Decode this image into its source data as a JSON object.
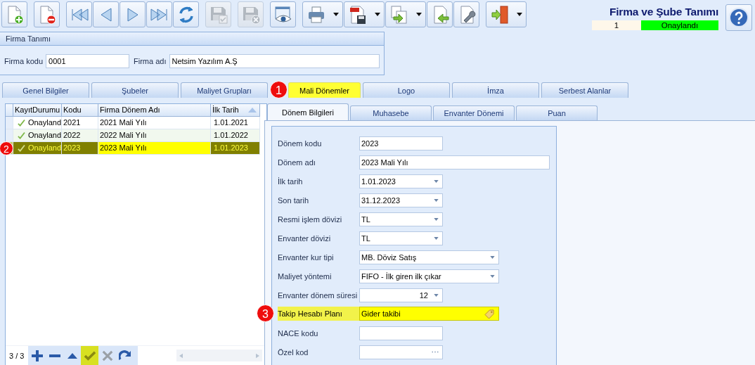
{
  "toolbar": [
    [
      {
        "kind": "new",
        "disabled": false,
        "dropdown": false
      }
    ],
    [
      {
        "kind": "delete",
        "disabled": false,
        "dropdown": false
      }
    ],
    [
      {
        "kind": "first",
        "disabled": false,
        "dropdown": false
      },
      {
        "kind": "prev",
        "disabled": false,
        "dropdown": false
      },
      {
        "kind": "next",
        "disabled": false,
        "dropdown": false
      },
      {
        "kind": "last",
        "disabled": false,
        "dropdown": false
      },
      {
        "kind": "refresh",
        "disabled": false,
        "dropdown": false
      }
    ],
    [
      {
        "kind": "save",
        "disabled": true,
        "dropdown": false
      }
    ],
    [
      {
        "kind": "cancel",
        "disabled": true,
        "dropdown": false
      }
    ],
    [
      {
        "kind": "preview",
        "disabled": false,
        "dropdown": false
      }
    ],
    [
      {
        "kind": "print",
        "disabled": false,
        "dropdown": true
      },
      {
        "kind": "pdf",
        "disabled": false,
        "dropdown": true
      },
      {
        "kind": "export",
        "disabled": false,
        "dropdown": true
      },
      {
        "kind": "import",
        "disabled": false,
        "dropdown": false
      },
      {
        "kind": "tools",
        "disabled": false,
        "dropdown": false
      }
    ],
    [
      {
        "kind": "exit",
        "disabled": false,
        "dropdown": true
      }
    ]
  ],
  "header": {
    "title": "Firma ve Şube Tanımı",
    "record_no": "1",
    "status": "Onaylandı"
  },
  "company": {
    "title": "Firma Tanımı",
    "fields": [
      {
        "label": "Firma kodu",
        "value": "0001"
      },
      {
        "label": "Firma adı",
        "value": "Netsim Yazılım A.Ş"
      }
    ]
  },
  "main_tabs": [
    {
      "label": "Genel Bilgiler",
      "selected": false
    },
    {
      "label": "Şubeler",
      "selected": false
    },
    {
      "label": "Maliyet Grupları",
      "selected": false
    },
    {
      "label": "Mali Dönemler",
      "selected": true,
      "marker": "1"
    },
    {
      "label": "Logo",
      "selected": false
    },
    {
      "label": "İmza",
      "selected": false
    },
    {
      "label": "Serbest Alanlar",
      "selected": false
    }
  ],
  "grid": {
    "columns": [
      {
        "label": "KayıtDurumu"
      },
      {
        "label": "Kodu"
      },
      {
        "label": "Firma Dönem Adı"
      },
      {
        "label": "İlk Tarih",
        "sorted": true
      }
    ],
    "rows": [
      {
        "status": "Onayland",
        "code": "2021",
        "name": "2021 Mali Yılı",
        "start": "1.01.2021",
        "selected": false
      },
      {
        "status": "Onayland",
        "code": "2022",
        "name": "2022 Mali Yılı",
        "start": "1.01.2022",
        "selected": false
      },
      {
        "status": "Onayland",
        "code": "2023",
        "name": "2023 Mali Yılı",
        "start": "1.01.2023",
        "selected": true,
        "marker": "2"
      }
    ],
    "position": "3 / 3",
    "navigator": [
      {
        "kind": "add",
        "highlighted": false,
        "disabled": false
      },
      {
        "kind": "remove",
        "highlighted": false,
        "disabled": false
      },
      {
        "kind": "up",
        "highlighted": false,
        "disabled": false
      },
      {
        "kind": "confirm",
        "highlighted": true,
        "disabled": false
      },
      {
        "kind": "cancel",
        "highlighted": false,
        "disabled": true
      },
      {
        "kind": "redo",
        "highlighted": false,
        "disabled": false
      }
    ]
  },
  "sub_tabs": [
    {
      "label": "Dönem Bilgileri",
      "selected": true
    },
    {
      "label": "Muhasebe",
      "selected": false
    },
    {
      "label": "Envanter Dönemi",
      "selected": false
    },
    {
      "label": "Puan",
      "selected": false
    }
  ],
  "form": [
    {
      "label": "Dönem kodu",
      "value": "2023",
      "kind": "text",
      "highlighted": false
    },
    {
      "label": "Dönem adı",
      "value": "2023 Mali Yılı",
      "kind": "text",
      "highlighted": false
    },
    {
      "label": "İlk tarih",
      "value": "1.01.2023",
      "kind": "combo",
      "highlighted": false
    },
    {
      "label": "Son tarih",
      "value": "31.12.2023",
      "kind": "combo",
      "highlighted": false
    },
    {
      "label": "Resmi işlem dövizi",
      "value": "TL",
      "kind": "combo",
      "highlighted": false
    },
    {
      "label": "Envanter dövizi",
      "value": "TL",
      "kind": "combo",
      "highlighted": false
    },
    {
      "label": "Envanter kur tipi",
      "value": "MB. Döviz Satış",
      "kind": "combo",
      "highlighted": false
    },
    {
      "label": "Maliyet yöntemi",
      "value": "FIFO - İlk giren ilk çıkar",
      "kind": "combo",
      "highlighted": false
    },
    {
      "label": "Envanter dönem süresi",
      "value": "12",
      "kind": "number",
      "highlighted": false
    },
    {
      "label": "Takip Hesabı Planı",
      "value": "Gider takibi",
      "kind": "lookup",
      "highlighted": true,
      "marker": "3"
    },
    {
      "label": "NACE kodu",
      "kind": "text",
      "highlighted": false
    },
    {
      "label": "Özel kod",
      "kind": "ellipsis",
      "highlighted": false
    }
  ]
}
